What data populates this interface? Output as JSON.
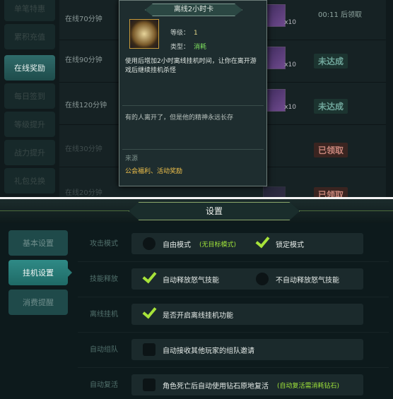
{
  "reward_panel": {
    "left_nav": [
      {
        "label": "单笔特惠"
      },
      {
        "label": "累积充值"
      },
      {
        "label": "在线奖励"
      },
      {
        "label": "每日签到"
      },
      {
        "label": "等级提升"
      },
      {
        "label": "战力提升"
      },
      {
        "label": "礼包兑换"
      }
    ],
    "rows": [
      {
        "time": "在线70分钟",
        "status": "00:11 后领取",
        "qty": "x10"
      },
      {
        "time": "在线90分钟",
        "status": "未达成",
        "qty": "x10"
      },
      {
        "time": "在线120分钟",
        "status": "未达成",
        "qty": "x10"
      },
      {
        "time": "在线30分钟",
        "status": "已领取",
        "qty": ""
      },
      {
        "time": "在线20分钟",
        "status": "已领取",
        "qty": ""
      }
    ]
  },
  "tooltip": {
    "title": "离线2小时卡",
    "level_label": "等级：",
    "level_value": "1",
    "type_label": "类型：",
    "type_value": "消耗",
    "description": "使用后增加2小时离线挂机时间，让你在离开游戏后继续挂机杀怪",
    "flavor": "有的人离开了，但是他的精神永远长存",
    "source_label": "来源",
    "source_value": "公会福利、活动奖励"
  },
  "settings": {
    "title": "设置",
    "tabs": [
      {
        "label": "基本设置"
      },
      {
        "label": "挂机设置"
      },
      {
        "label": "消费提醒"
      }
    ],
    "rows": [
      {
        "name": "攻击模式",
        "opt1": "自由模式",
        "note1": "(无目标模式)",
        "opt2": "锁定模式"
      },
      {
        "name": "技能释放",
        "opt1": "自动释放怒气技能",
        "opt2": "不自动释放怒气技能"
      },
      {
        "name": "离线挂机",
        "opt1": "是否开启离线挂机功能"
      },
      {
        "name": "自动组队",
        "opt1": "自动接收其他玩家的组队邀请"
      },
      {
        "name": "自动复活",
        "opt1": "角色死亡后自动使用钻石原地复活",
        "note1": "(自动复活需消耗钻石)"
      }
    ]
  }
}
